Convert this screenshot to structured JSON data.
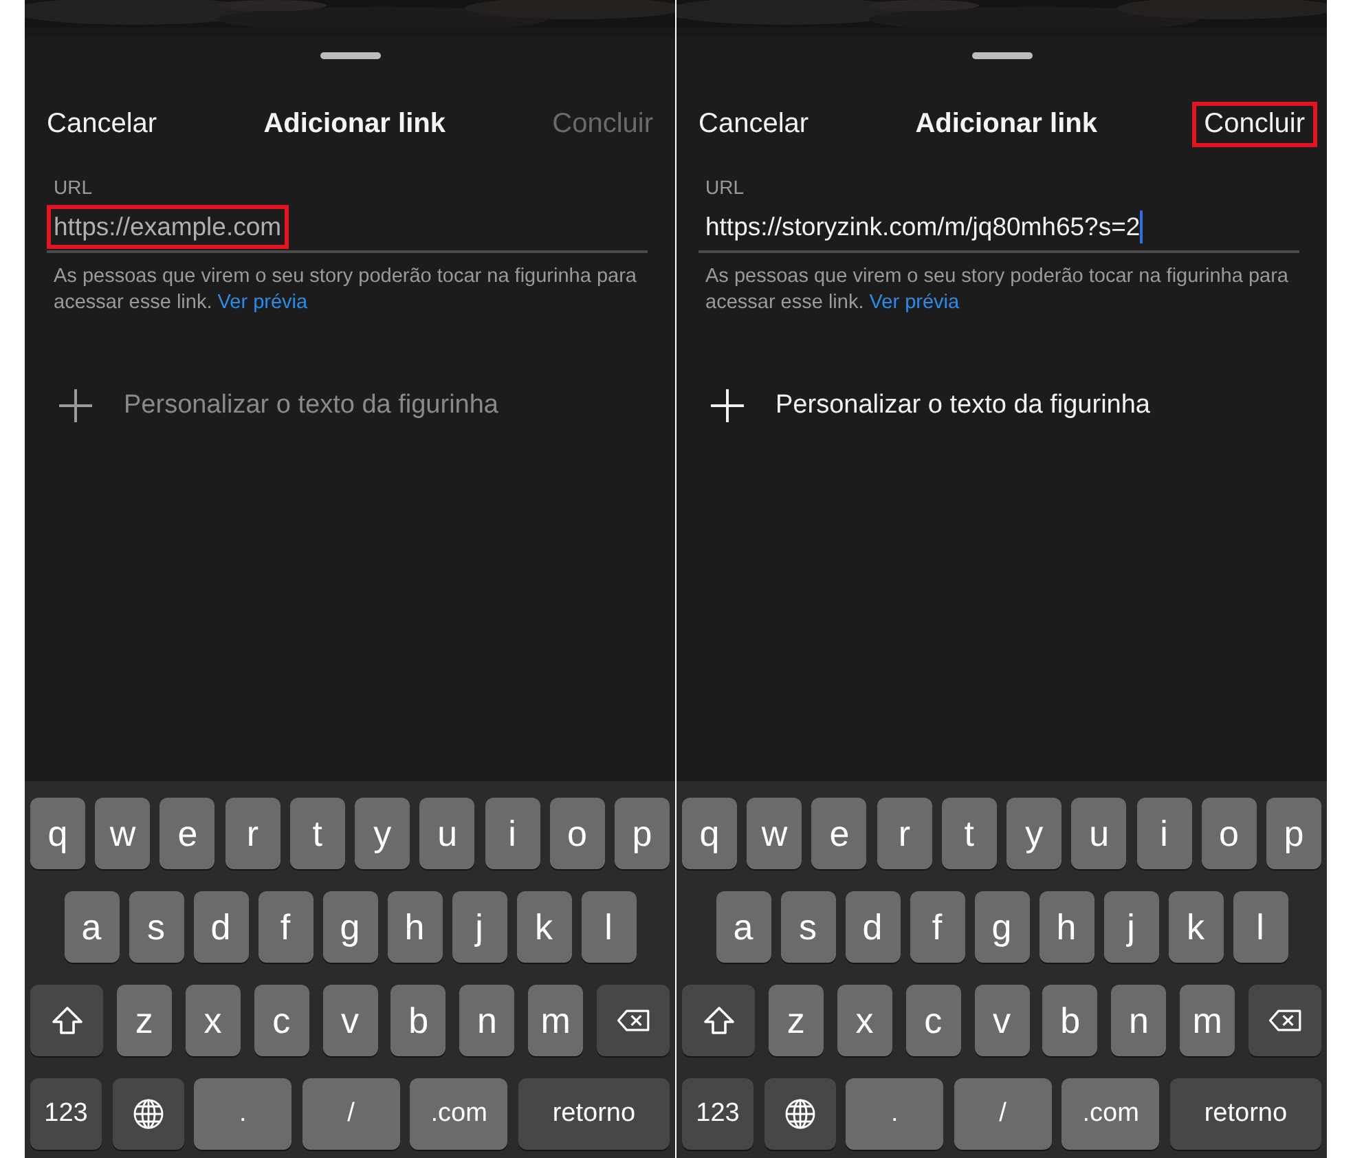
{
  "screens": [
    {
      "header": {
        "cancel": "Cancelar",
        "title": "Adicionar link",
        "done": {
          "label": "Concluir",
          "disabled": true,
          "highlighted": false
        }
      },
      "url_field": {
        "label": "URL",
        "placeholder": "https://example.com",
        "focused": false,
        "highlighted": true
      },
      "helper": {
        "text": "As pessoas que virem o seu story poderão tocar na figurinha para acessar esse link.",
        "link": "Ver prévia"
      },
      "customize": {
        "label": "Personalizar o texto da figurinha",
        "disabled": true
      },
      "keyboard": [
        [
          {
            "kind": "letter",
            "label": "q"
          },
          {
            "kind": "letter",
            "label": "w"
          },
          {
            "kind": "letter",
            "label": "e"
          },
          {
            "kind": "letter",
            "label": "r"
          },
          {
            "kind": "letter",
            "label": "t"
          },
          {
            "kind": "letter",
            "label": "y"
          },
          {
            "kind": "letter",
            "label": "u"
          },
          {
            "kind": "letter",
            "label": "i"
          },
          {
            "kind": "letter",
            "label": "o"
          },
          {
            "kind": "letter",
            "label": "p"
          }
        ],
        [
          {
            "kind": "letter",
            "label": "a"
          },
          {
            "kind": "letter",
            "label": "s"
          },
          {
            "kind": "letter",
            "label": "d"
          },
          {
            "kind": "letter",
            "label": "f"
          },
          {
            "kind": "letter",
            "label": "g"
          },
          {
            "kind": "letter",
            "label": "h"
          },
          {
            "kind": "letter",
            "label": "j"
          },
          {
            "kind": "letter",
            "label": "k"
          },
          {
            "kind": "letter",
            "label": "l"
          }
        ],
        [
          {
            "kind": "shift"
          },
          {
            "kind": "letter",
            "label": "z"
          },
          {
            "kind": "letter",
            "label": "x"
          },
          {
            "kind": "letter",
            "label": "c"
          },
          {
            "kind": "letter",
            "label": "v"
          },
          {
            "kind": "letter",
            "label": "b"
          },
          {
            "kind": "letter",
            "label": "n"
          },
          {
            "kind": "letter",
            "label": "m"
          },
          {
            "kind": "delete"
          }
        ],
        [
          {
            "kind": "function",
            "label": "123"
          },
          {
            "kind": "globe"
          },
          {
            "kind": "wide",
            "label": "."
          },
          {
            "kind": "wide",
            "label": "/"
          },
          {
            "kind": "wide",
            "label": ".com"
          },
          {
            "kind": "return",
            "label": "retorno"
          }
        ]
      ]
    },
    {
      "header": {
        "cancel": "Cancelar",
        "title": "Adicionar link",
        "done": {
          "label": "Concluir",
          "disabled": false,
          "highlighted": true
        }
      },
      "url_field": {
        "label": "URL",
        "value": "https://storyzink.com/m/jq80mh65?s=2",
        "focused": true,
        "highlighted": false
      },
      "helper": {
        "text": "As pessoas que virem o seu story poderão tocar na figurinha para acessar esse link.",
        "link": "Ver prévia"
      },
      "customize": {
        "label": "Personalizar o texto da figurinha",
        "disabled": false
      },
      "keyboard": [
        [
          {
            "kind": "letter",
            "label": "q"
          },
          {
            "kind": "letter",
            "label": "w"
          },
          {
            "kind": "letter",
            "label": "e"
          },
          {
            "kind": "letter",
            "label": "r"
          },
          {
            "kind": "letter",
            "label": "t"
          },
          {
            "kind": "letter",
            "label": "y"
          },
          {
            "kind": "letter",
            "label": "u"
          },
          {
            "kind": "letter",
            "label": "i"
          },
          {
            "kind": "letter",
            "label": "o"
          },
          {
            "kind": "letter",
            "label": "p"
          }
        ],
        [
          {
            "kind": "letter",
            "label": "a"
          },
          {
            "kind": "letter",
            "label": "s"
          },
          {
            "kind": "letter",
            "label": "d"
          },
          {
            "kind": "letter",
            "label": "f"
          },
          {
            "kind": "letter",
            "label": "g"
          },
          {
            "kind": "letter",
            "label": "h"
          },
          {
            "kind": "letter",
            "label": "j"
          },
          {
            "kind": "letter",
            "label": "k"
          },
          {
            "kind": "letter",
            "label": "l"
          }
        ],
        [
          {
            "kind": "shift"
          },
          {
            "kind": "letter",
            "label": "z"
          },
          {
            "kind": "letter",
            "label": "x"
          },
          {
            "kind": "letter",
            "label": "c"
          },
          {
            "kind": "letter",
            "label": "v"
          },
          {
            "kind": "letter",
            "label": "b"
          },
          {
            "kind": "letter",
            "label": "n"
          },
          {
            "kind": "letter",
            "label": "m"
          },
          {
            "kind": "delete"
          }
        ],
        [
          {
            "kind": "function",
            "label": "123"
          },
          {
            "kind": "globe"
          },
          {
            "kind": "wide",
            "label": "."
          },
          {
            "kind": "wide",
            "label": "/"
          },
          {
            "kind": "wide",
            "label": ".com"
          },
          {
            "kind": "return",
            "label": "retorno"
          }
        ]
      ]
    }
  ]
}
